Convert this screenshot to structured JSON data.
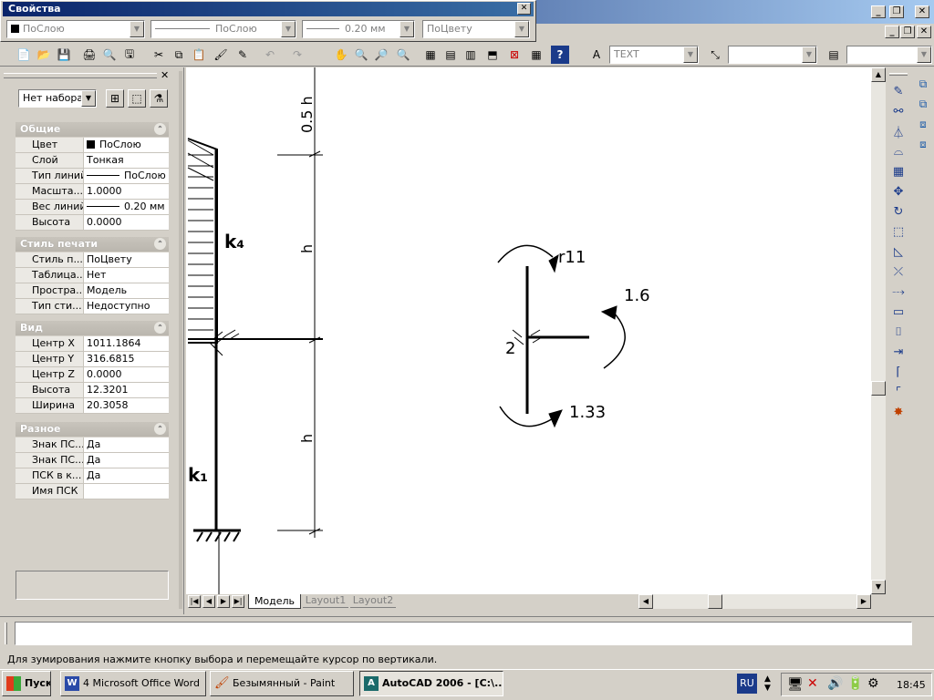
{
  "properties_window": {
    "title": "Свойства"
  },
  "properties_toolbar": {
    "layer_combo": "ПоСлою",
    "linetype_combo": "ПоСлою",
    "lineweight_combo": "0.20 мм",
    "plotstyle_combo": "ПоЦвету"
  },
  "standard_toolbar": {
    "text_style_combo": "TEXT",
    "dim_style_combo": "",
    "extra_combo": ""
  },
  "palette": {
    "selection_combo": "Нет набора",
    "sections": [
      {
        "title": "Общие",
        "rows": [
          {
            "key": "Цвет",
            "value": "ПоСлою"
          },
          {
            "key": "Слой",
            "value": "Тонкая"
          },
          {
            "key": "Тип линий",
            "value": "ПоСлою"
          },
          {
            "key": "Масшта...",
            "value": "1.0000"
          },
          {
            "key": "Вес линий",
            "value": "0.20 мм"
          },
          {
            "key": "Высота",
            "value": "0.0000"
          }
        ]
      },
      {
        "title": "Стиль печати",
        "rows": [
          {
            "key": "Стиль п...",
            "value": "ПоЦвету"
          },
          {
            "key": "Таблица...",
            "value": "Нет"
          },
          {
            "key": "Простра...",
            "value": "Модель"
          },
          {
            "key": "Тип сти...",
            "value": "Недоступно"
          }
        ]
      },
      {
        "title": "Вид",
        "rows": [
          {
            "key": "Центр X",
            "value": "1011.1864"
          },
          {
            "key": "Центр Y",
            "value": "316.6815"
          },
          {
            "key": "Центр Z",
            "value": "0.0000"
          },
          {
            "key": "Высота",
            "value": "12.3201"
          },
          {
            "key": "Ширина",
            "value": "20.3058"
          }
        ]
      },
      {
        "title": "Разное",
        "rows": [
          {
            "key": "Знак ПС...",
            "value": "Да"
          },
          {
            "key": "Знак ПС...",
            "value": "Да"
          },
          {
            "key": "ПСК в к...",
            "value": "Да"
          },
          {
            "key": "Имя ПСК",
            "value": ""
          }
        ]
      }
    ]
  },
  "drawing": {
    "dim_labels": [
      "0.5 h",
      "h",
      "h"
    ],
    "column_labels": [
      "k₄",
      "k₁"
    ],
    "node_label": "2",
    "moment_labels": [
      "r11",
      "1.6",
      "1.33"
    ]
  },
  "layout_tabs": [
    "Модель",
    "Layout1",
    "Layout2"
  ],
  "status_text": "Для зумирования нажмите кнопку выбора и перемещайте курсор по вертикали.",
  "taskbar": {
    "start_label": "Пуск",
    "tasks": [
      "4 Microsoft Office Word",
      "Безымянный - Paint",
      "AutoCAD 2006 - [C:\\..."
    ],
    "language": "RU",
    "clock": "18:45"
  },
  "colors": {
    "title_bar": "#0a246a",
    "desktop": "#3a6ea5",
    "canvas": "#ffffff"
  }
}
